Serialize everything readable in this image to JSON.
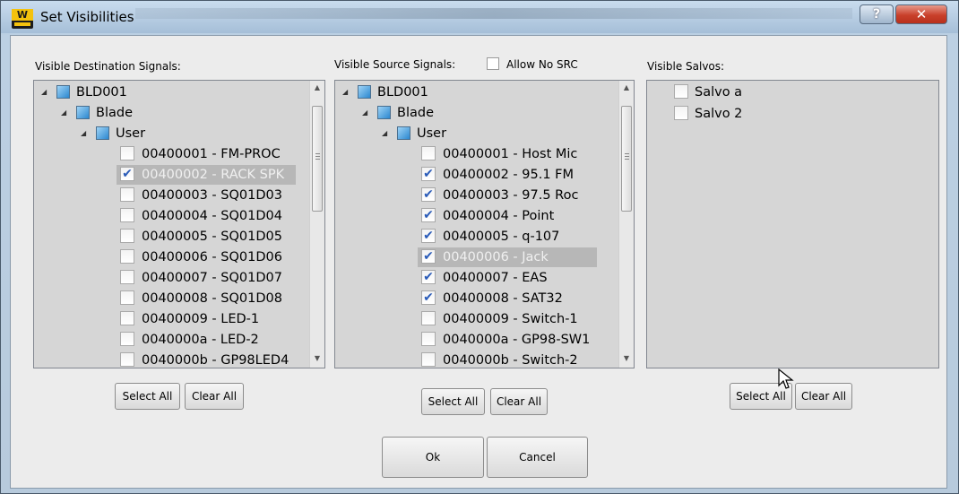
{
  "window": {
    "title": "Set Visibilities",
    "app_icon": "w-logo-icon",
    "help_label": "?",
    "close_label": "✕"
  },
  "destinations": {
    "header": "Visible Destination Signals:",
    "tree": [
      {
        "label": "BLD001",
        "level": 0,
        "type": "folder",
        "expanded": true
      },
      {
        "label": "Blade",
        "level": 1,
        "type": "folder",
        "expanded": true
      },
      {
        "label": "User",
        "level": 2,
        "type": "folder",
        "expanded": true
      },
      {
        "label": "00400001 - FM-PROC",
        "level": 3,
        "type": "item",
        "checked": false
      },
      {
        "label": "00400002 - RACK SPK",
        "level": 3,
        "type": "item",
        "checked": true,
        "selected": true
      },
      {
        "label": "00400003 - SQ01D03",
        "level": 3,
        "type": "item",
        "checked": false
      },
      {
        "label": "00400004 - SQ01D04",
        "level": 3,
        "type": "item",
        "checked": false
      },
      {
        "label": "00400005 - SQ01D05",
        "level": 3,
        "type": "item",
        "checked": false
      },
      {
        "label": "00400006 - SQ01D06",
        "level": 3,
        "type": "item",
        "checked": false
      },
      {
        "label": "00400007 - SQ01D07",
        "level": 3,
        "type": "item",
        "checked": false
      },
      {
        "label": "00400008 - SQ01D08",
        "level": 3,
        "type": "item",
        "checked": false
      },
      {
        "label": "00400009 - LED-1",
        "level": 3,
        "type": "item",
        "checked": false
      },
      {
        "label": "0040000a - LED-2",
        "level": 3,
        "type": "item",
        "checked": false
      },
      {
        "label": "0040000b - GP98LED4",
        "level": 3,
        "type": "item",
        "checked": false
      }
    ],
    "select_all": "Select All",
    "clear_all": "Clear All"
  },
  "sources": {
    "header": "Visible Source Signals:",
    "allow_no_src": "Allow No SRC",
    "allow_no_src_checked": false,
    "tree": [
      {
        "label": "BLD001",
        "level": 0,
        "type": "folder",
        "expanded": true
      },
      {
        "label": "Blade",
        "level": 1,
        "type": "folder",
        "expanded": true
      },
      {
        "label": "User",
        "level": 2,
        "type": "folder",
        "expanded": true
      },
      {
        "label": "00400001 - Host Mic",
        "level": 3,
        "type": "item",
        "checked": false
      },
      {
        "label": "00400002 - 95.1 FM",
        "level": 3,
        "type": "item",
        "checked": true
      },
      {
        "label": "00400003 - 97.5 Roc",
        "level": 3,
        "type": "item",
        "checked": true
      },
      {
        "label": "00400004 - Point",
        "level": 3,
        "type": "item",
        "checked": true
      },
      {
        "label": "00400005 - q-107",
        "level": 3,
        "type": "item",
        "checked": true
      },
      {
        "label": "00400006 - Jack",
        "level": 3,
        "type": "item",
        "checked": true,
        "selected": true
      },
      {
        "label": "00400007 - EAS",
        "level": 3,
        "type": "item",
        "checked": true
      },
      {
        "label": "00400008 - SAT32",
        "level": 3,
        "type": "item",
        "checked": true
      },
      {
        "label": "00400009 - Switch-1",
        "level": 3,
        "type": "item",
        "checked": false
      },
      {
        "label": "0040000a - GP98-SW1",
        "level": 3,
        "type": "item",
        "checked": false
      },
      {
        "label": "0040000b - Switch-2",
        "level": 3,
        "type": "item",
        "checked": false
      }
    ],
    "select_all": "Select All",
    "clear_all": "Clear All"
  },
  "salvos": {
    "header": "Visible Salvos:",
    "items": [
      {
        "label": "Salvo  a",
        "checked": false
      },
      {
        "label": "Salvo  2",
        "checked": false
      }
    ],
    "select_all": "Select All",
    "clear_all": "Clear All"
  },
  "footer": {
    "ok": "Ok",
    "cancel": "Cancel"
  },
  "colors": {
    "check_mark": "#2a5bb8",
    "selected_row": "#b7b7b7",
    "list_bg": "#d6d6d6",
    "selected_text": "#f0f0f0"
  }
}
